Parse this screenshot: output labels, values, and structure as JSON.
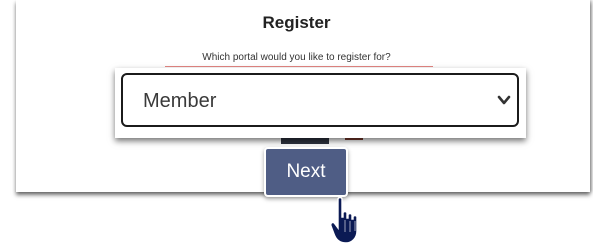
{
  "register": {
    "title": "Register",
    "subtitle": "Which portal would you like to register for?",
    "portal_select": {
      "selected": "Member",
      "icon": "chevron-down-icon"
    },
    "next_label": "Next"
  },
  "cursor": {
    "icon": "hand-pointer-icon"
  },
  "colors": {
    "button": "#4f5d85",
    "select_border": "#1b1b1b",
    "cursor": "#0b1a54"
  }
}
